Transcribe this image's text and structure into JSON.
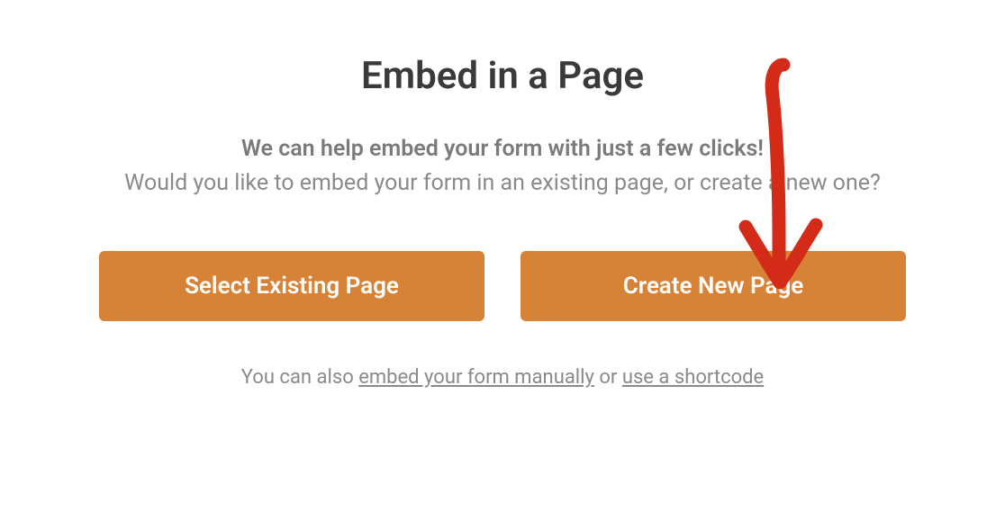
{
  "modal": {
    "title": "Embed in a Page",
    "subtitle_bold": "We can help embed your form with just a few clicks!",
    "subtitle_rest": "Would you like to embed your form in an existing page, or create a new one?",
    "buttons": {
      "select_existing": "Select Existing Page",
      "create_new": "Create New Page"
    },
    "footer": {
      "prefix": "You can also ",
      "link_manual": "embed your form manually",
      "middle": " or ",
      "link_shortcode": "use a shortcode"
    }
  },
  "colors": {
    "button_bg": "#d68237",
    "annotation": "#d42a18"
  }
}
